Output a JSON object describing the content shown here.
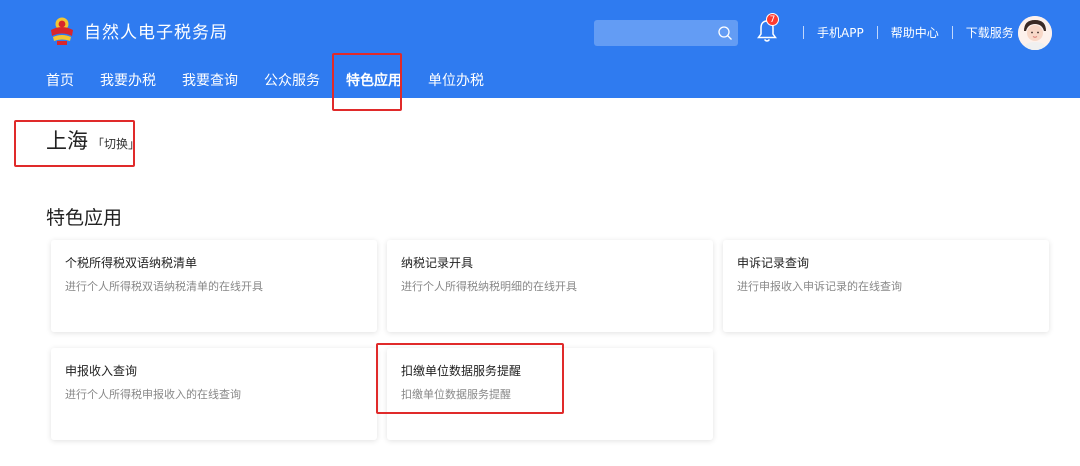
{
  "header": {
    "title": "自然人电子税务局",
    "notification_count": "7",
    "links": [
      "手机APP",
      "帮助中心",
      "下载服务"
    ]
  },
  "nav": {
    "items": [
      {
        "label": "首页",
        "active": false
      },
      {
        "label": "我要办税",
        "active": false
      },
      {
        "label": "我要查询",
        "active": false
      },
      {
        "label": "公众服务",
        "active": false
      },
      {
        "label": "特色应用",
        "active": true
      },
      {
        "label": "单位办税",
        "active": false
      }
    ]
  },
  "region": {
    "name": "上海",
    "switch_label": "「切换」"
  },
  "section": {
    "title": "特色应用"
  },
  "cards": [
    {
      "title": "个税所得税双语纳税清单",
      "desc": "进行个人所得税双语纳税清单的在线开具"
    },
    {
      "title": "纳税记录开具",
      "desc": "进行个人所得税纳税明细的在线开具"
    },
    {
      "title": "申诉记录查询",
      "desc": "进行申报收入申诉记录的在线查询"
    },
    {
      "title": "申报收入查询",
      "desc": "进行个人所得税申报收入的在线查询"
    },
    {
      "title": "扣缴单位数据服务提醒",
      "desc": "扣缴单位数据服务提醒"
    }
  ],
  "colors": {
    "header_bg": "#2f7bf0",
    "highlight": "#e02a2a",
    "badge": "#ff3b30"
  }
}
